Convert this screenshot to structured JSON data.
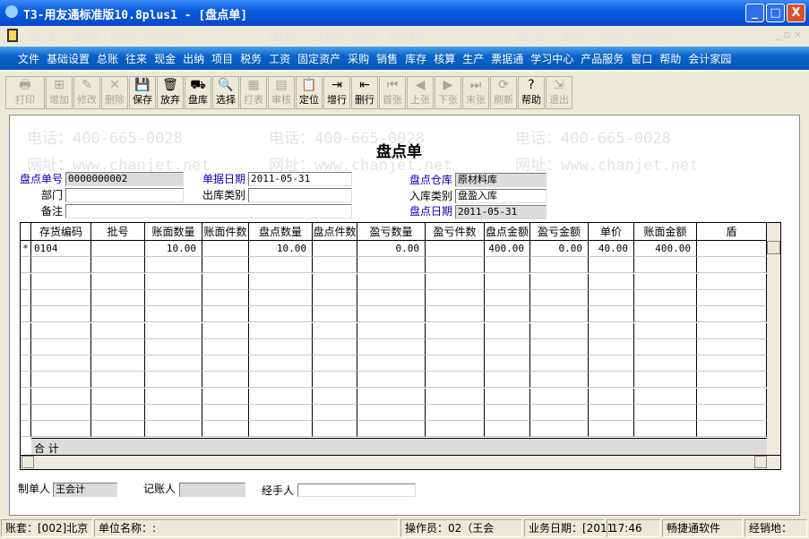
{
  "window": {
    "title": "T3-用友通标准版10.8plus1 - [盘点单]",
    "min": "_",
    "max": "□",
    "close": "X"
  },
  "watermark": {
    "phone": "电话：400-665-0028",
    "site": "网址：www.chanjet.net"
  },
  "menu": [
    "文件",
    "基础设置",
    "总账",
    "往来",
    "现金",
    "出纳",
    "项目",
    "税务",
    "工资",
    "固定资产",
    "采购",
    "销售",
    "库存",
    "核算",
    "生产",
    "票据通",
    "学习中心",
    "产品服务",
    "窗口",
    "帮助",
    "会计家园"
  ],
  "toolbar": [
    {
      "label": "打印",
      "icon": "🖶",
      "enabled": false
    },
    {
      "label": "增加",
      "icon": "⊞",
      "enabled": false
    },
    {
      "label": "修改",
      "icon": "✎",
      "enabled": false
    },
    {
      "label": "删除",
      "icon": "✕",
      "enabled": false
    },
    {
      "label": "保存",
      "icon": "💾",
      "enabled": true
    },
    {
      "label": "放弃",
      "icon": "🗑",
      "enabled": true
    },
    {
      "label": "盘库",
      "icon": "⛟",
      "enabled": true
    },
    {
      "label": "选择",
      "icon": "🔍",
      "enabled": true
    },
    {
      "label": "打表",
      "icon": "▦",
      "enabled": false
    },
    {
      "label": "审核",
      "icon": "▤",
      "enabled": false
    },
    {
      "label": "定位",
      "icon": "📋",
      "enabled": true
    },
    {
      "label": "增行",
      "icon": "⇥",
      "enabled": true
    },
    {
      "label": "删行",
      "icon": "⇤",
      "enabled": true
    },
    {
      "label": "首张",
      "icon": "⏮",
      "enabled": false
    },
    {
      "label": "上张",
      "icon": "◀",
      "enabled": false
    },
    {
      "label": "下张",
      "icon": "▶",
      "enabled": false
    },
    {
      "label": "末张",
      "icon": "⏭",
      "enabled": false
    },
    {
      "label": "刷新",
      "icon": "⟳",
      "enabled": false
    },
    {
      "label": "帮助",
      "icon": "?",
      "enabled": true
    },
    {
      "label": "退出",
      "icon": "⇲",
      "enabled": false
    }
  ],
  "form": {
    "title": "盘点单",
    "doc_no_label": "盘点单号",
    "doc_no": "0000000002",
    "doc_date_label": "单据日期",
    "doc_date": "2011-05-31",
    "warehouse_label": "盘点仓库",
    "warehouse": "原材料库",
    "dept_label": "部门",
    "dept": "",
    "out_type_label": "出库类别",
    "out_type": "",
    "in_type_label": "入库类别",
    "in_type": "盘盈入库",
    "remark_label": "备注",
    "remark": "",
    "check_date_label": "盘点日期",
    "check_date": "2011-05-31"
  },
  "grid": {
    "columns": [
      "存货编码",
      "批号",
      "账面数量",
      "账面件数",
      "盘点数量",
      "盘点件数",
      "盈亏数量",
      "盈亏件数",
      "盘点金额",
      "盈亏金额",
      "单价",
      "账面金额",
      "盾"
    ],
    "rows": [
      {
        "marker": "*",
        "cells": [
          "0104",
          "",
          "10.00",
          "",
          "10.00",
          "",
          "0.00",
          "",
          "400.00",
          "0.00",
          "40.00",
          "400.00",
          ""
        ]
      }
    ],
    "total_label": "合  计"
  },
  "footer": {
    "maker_label": "制单人",
    "maker": "王会计",
    "bookkeeper_label": "记账人",
    "bookkeeper": "",
    "handler_label": "经手人",
    "handler": ""
  },
  "status": [
    "账套：[002]北京",
    "单位名称：:",
    "操作员：02（王会",
    "业务日期：[2011",
    "17:46",
    "畅捷通软件",
    "经销地："
  ]
}
